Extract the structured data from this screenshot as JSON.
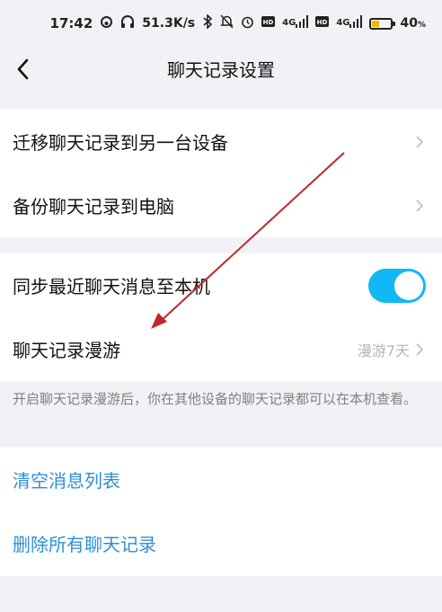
{
  "status_bar": {
    "time": "17:42",
    "net_speed": "51.3K/s",
    "network_1": "4G",
    "network_2": "4G",
    "battery_percent": "40",
    "battery_level": 0.4,
    "icons": [
      "sync-icon",
      "headset-icon",
      "bluetooth-icon",
      "mute-icon",
      "alarm-icon",
      "hd-icon",
      "signal-icon",
      "hd-icon",
      "signal-icon",
      "battery-icon"
    ]
  },
  "header": {
    "title": "聊天记录设置",
    "back_icon": "chevron-left-icon"
  },
  "group1": {
    "items": [
      {
        "label": "迁移聊天记录到另一台设备"
      },
      {
        "label": "备份聊天记录到电脑"
      }
    ]
  },
  "group2": {
    "sync": {
      "label": "同步最近聊天消息至本机",
      "enabled": true
    },
    "roaming": {
      "label": "聊天记录漫游",
      "value": "漫游7天"
    }
  },
  "roaming_desc": "开启聊天记录漫游后，你在其他设备的聊天记录都可以在本机查看。",
  "group3": {
    "clear_label": "清空消息列表",
    "delete_label": "删除所有聊天记录"
  },
  "colors": {
    "accent": "#12b7f5",
    "link": "#2e8fd6",
    "background": "#f2f2f6",
    "annotation": "#c0282a"
  }
}
